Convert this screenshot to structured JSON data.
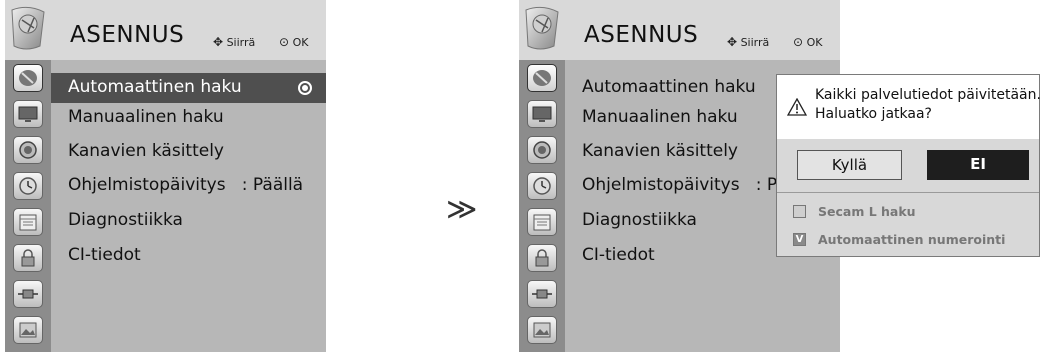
{
  "left_panel": {
    "title": "ASENNUS",
    "hint_move": "Siirrä",
    "hint_ok": "OK",
    "menu": [
      {
        "label": "Automaattinen haku",
        "selected": true
      },
      {
        "label": "Manuaalinen haku"
      },
      {
        "label": "Kanavien käsittely"
      },
      {
        "label": "Ohjelmistopäivitys   : Päällä"
      },
      {
        "label": "Diagnostiikka"
      },
      {
        "label": "CI-tiedot"
      }
    ],
    "sidebar_icons": [
      "satellite-dish-icon",
      "tv-screen-icon",
      "speaker-icon",
      "clock-icon",
      "calendar-icon",
      "lock-icon",
      "plug-icon",
      "photo-icon"
    ]
  },
  "arrow_text": "≫",
  "right_panel": {
    "title": "ASENNUS",
    "hint_move": "Siirrä",
    "hint_ok": "OK",
    "menu": [
      {
        "label": "Automaattinen haku",
        "selected": false
      },
      {
        "label": "Manuaalinen haku"
      },
      {
        "label": "Kanavien käsittely"
      },
      {
        "label": "Ohjelmistopäivitys   : Pä"
      },
      {
        "label": "Diagnostiikka"
      },
      {
        "label": "CI-tiedot"
      }
    ]
  },
  "dialog": {
    "message_line1": "Kaikki palvelutiedot päivitetään.",
    "message_line2": "Haluatko jatkaa?",
    "yes_label": "Kyllä",
    "no_label": "EI",
    "options": [
      {
        "label": "Secam L haku",
        "checked": false,
        "mark": ""
      },
      {
        "label": "Automaattinen numerointi",
        "checked": true,
        "mark": "V"
      }
    ]
  },
  "colors": {
    "header_bg": "#d9d9d9",
    "sidebar_bg": "#8c8c8c",
    "content_bg": "#b7b7b7",
    "selected_bg": "#4f4f4f",
    "button_no_bg": "#1e1e1e"
  }
}
